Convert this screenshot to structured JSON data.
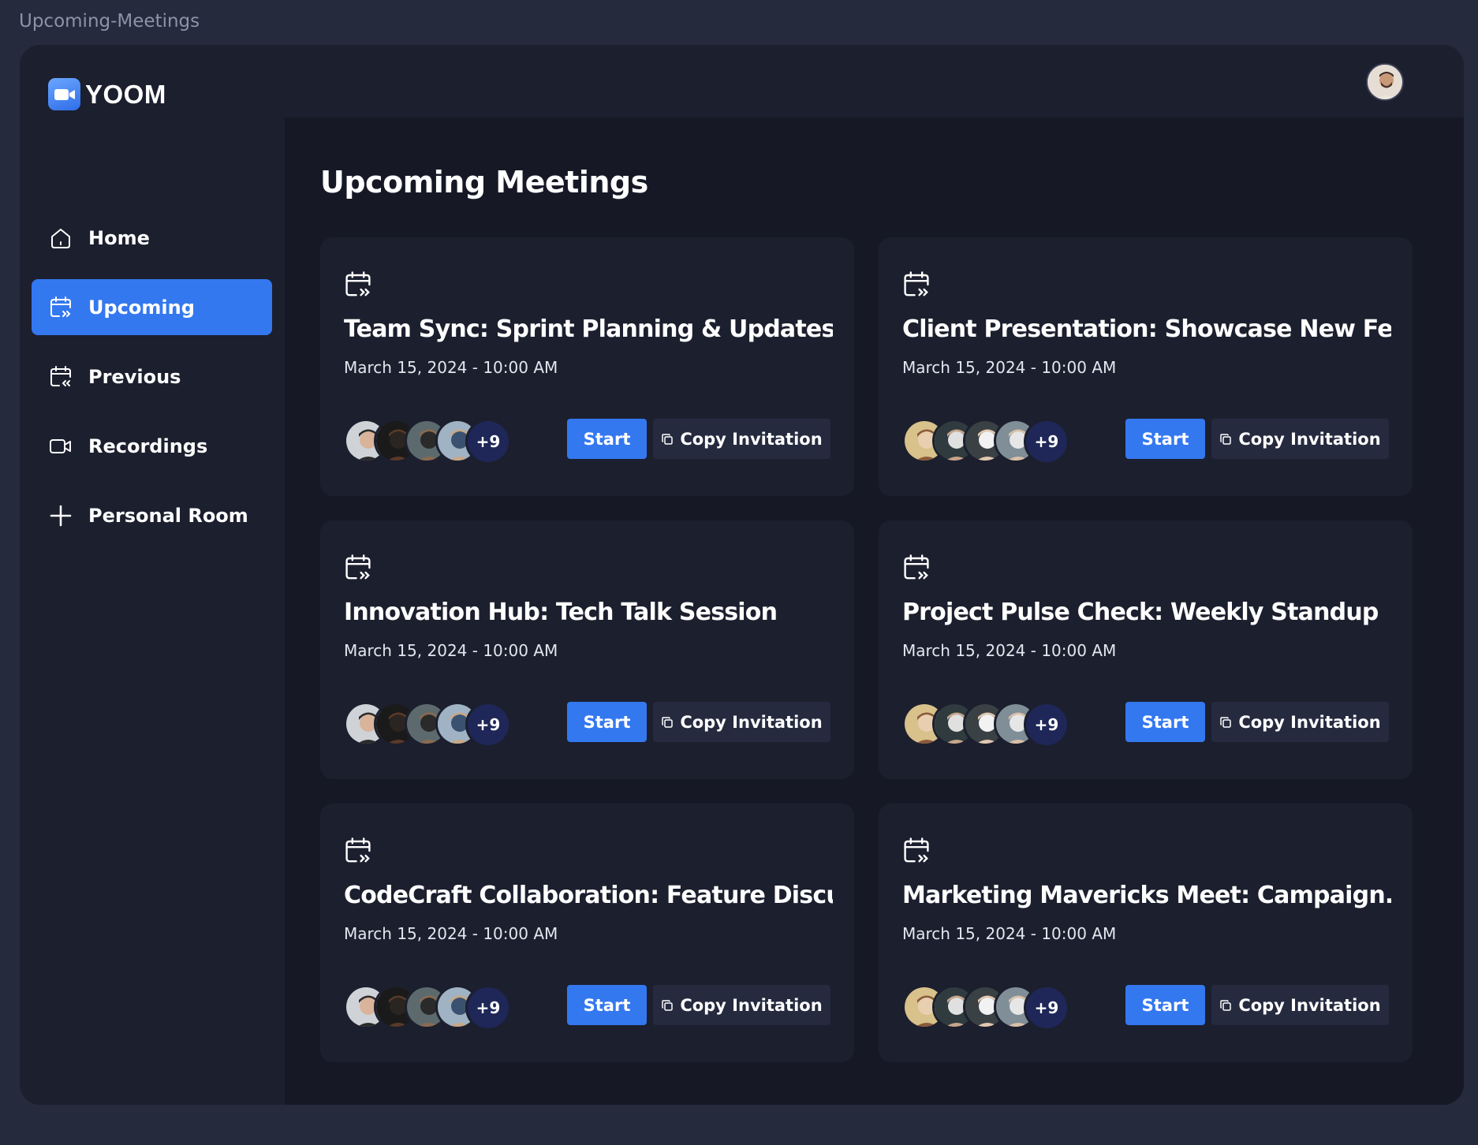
{
  "frame_title": "Upcoming-Meetings",
  "app": {
    "name": "YOOM"
  },
  "sidebar": {
    "items": [
      {
        "label": "Home",
        "icon": "home-icon",
        "active": false
      },
      {
        "label": "Upcoming",
        "icon": "calendar-upcoming-icon",
        "active": true
      },
      {
        "label": "Previous",
        "icon": "calendar-previous-icon",
        "active": false
      },
      {
        "label": "Recordings",
        "icon": "video-icon",
        "active": false
      },
      {
        "label": "Personal Room",
        "icon": "plus-icon",
        "active": false
      }
    ]
  },
  "main": {
    "title": "Upcoming Meetings",
    "meetings": [
      {
        "title": "Team Sync: Sprint Planning & Updates",
        "date": "March 15, 2024 - 10:00 AM",
        "more": "+9",
        "start": "Start",
        "copy": "Copy Invitation"
      },
      {
        "title": "Client Presentation: Showcase New Fe...",
        "date": "March 15, 2024 - 10:00 AM",
        "more": "+9",
        "start": "Start",
        "copy": "Copy Invitation"
      },
      {
        "title": "Innovation Hub: Tech Talk Session",
        "date": "March 15, 2024 - 10:00 AM",
        "more": "+9",
        "start": "Start",
        "copy": "Copy Invitation"
      },
      {
        "title": "Project Pulse Check: Weekly Standup",
        "date": "March 15, 2024 - 10:00 AM",
        "more": "+9",
        "start": "Start",
        "copy": "Copy Invitation"
      },
      {
        "title": "CodeCraft Collaboration: Feature Discu...",
        "date": "March 15, 2024 - 10:00 AM",
        "more": "+9",
        "start": "Start",
        "copy": "Copy Invitation"
      },
      {
        "title": "Marketing Mavericks Meet: Campaign...",
        "date": "March 15, 2024 - 10:00 AM",
        "more": "+9",
        "start": "Start",
        "copy": "Copy Invitation"
      }
    ]
  },
  "colors": {
    "accent": "#3478f0",
    "background": "#252a3d",
    "panel": "#1c1f2e",
    "main": "#161925",
    "more_badge": "#1e2757"
  }
}
